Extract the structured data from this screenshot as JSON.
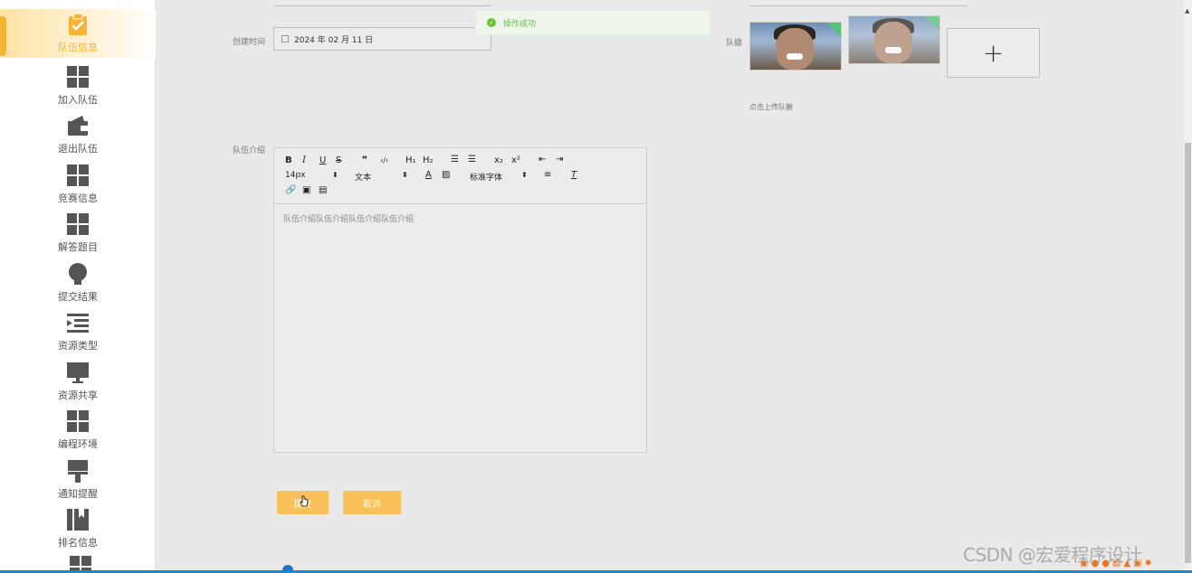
{
  "sidebar": {
    "items": [
      {
        "label": "队伍信息",
        "icon": "clipboard-check-icon",
        "active": true
      },
      {
        "label": "加入队伍",
        "icon": "grid-icon"
      },
      {
        "label": "退出队伍",
        "icon": "wallet-icon"
      },
      {
        "label": "竞赛信息",
        "icon": "grid-icon"
      },
      {
        "label": "解答题目",
        "icon": "grid-icon"
      },
      {
        "label": "提交结果",
        "icon": "lightbulb-icon"
      },
      {
        "label": "资源类型",
        "icon": "indent-list-icon"
      },
      {
        "label": "资源共享",
        "icon": "monitor-icon"
      },
      {
        "label": "编程环境",
        "icon": "grid-icon"
      },
      {
        "label": "通知提醒",
        "icon": "paint-roller-icon"
      },
      {
        "label": "排名信息",
        "icon": "book-icon"
      }
    ]
  },
  "form": {
    "create_time_label": "创建时间",
    "create_time_value": "2024 年 02 月 11 日",
    "avatar_label": "队徽",
    "upload_tip": "点击上传队徽",
    "upload_plus": "+",
    "intro_label": "队伍介绍",
    "intro_content": "队伍介绍队伍介绍队伍介绍队伍介绍"
  },
  "toast": {
    "text": "操作成功",
    "color": "#67c23a"
  },
  "editor": {
    "font_size": "14px",
    "text_type": "文本",
    "font_family": "标准字体"
  },
  "buttons": {
    "submit": "提交",
    "cancel": "取消"
  },
  "watermark": "CSDN @宏爱程序设计",
  "colors": {
    "accent": "#f5b433",
    "button": "#fbc05a",
    "success": "#67c23a"
  }
}
